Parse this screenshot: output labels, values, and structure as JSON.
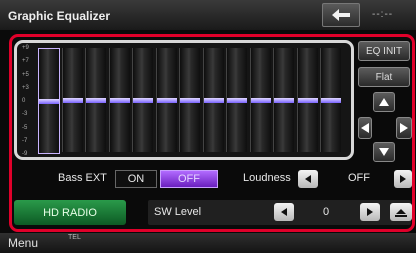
{
  "header": {
    "title": "Graphic Equalizer",
    "clock": "--:--"
  },
  "eq": {
    "scale_labels": [
      "+9",
      "+7",
      "+5",
      "+3",
      "0",
      "-3",
      "-5",
      "-7",
      "-9"
    ],
    "band_count": 13,
    "band_levels_db": [
      0,
      0,
      0,
      0,
      0,
      0,
      0,
      0,
      0,
      0,
      0,
      0,
      0
    ],
    "selected_band": 1
  },
  "side_buttons": {
    "eq_init": "EQ INIT",
    "flat": "Flat"
  },
  "bass": {
    "label": "Bass EXT",
    "on_label": "ON",
    "off_label": "OFF",
    "selected": "OFF"
  },
  "loudness": {
    "label": "Loudness",
    "value": "OFF"
  },
  "bottom": {
    "source_button": "HD RADIO",
    "sw_label": "SW Level",
    "sw_value": "0"
  },
  "footer": {
    "menu": "Menu",
    "tel": "TEL"
  },
  "colors": {
    "frame_red": "#e0002a",
    "slider_purple": "#7a62ff",
    "off_selected": "#8a3bd8",
    "hd_green": "#1f8a3e"
  }
}
